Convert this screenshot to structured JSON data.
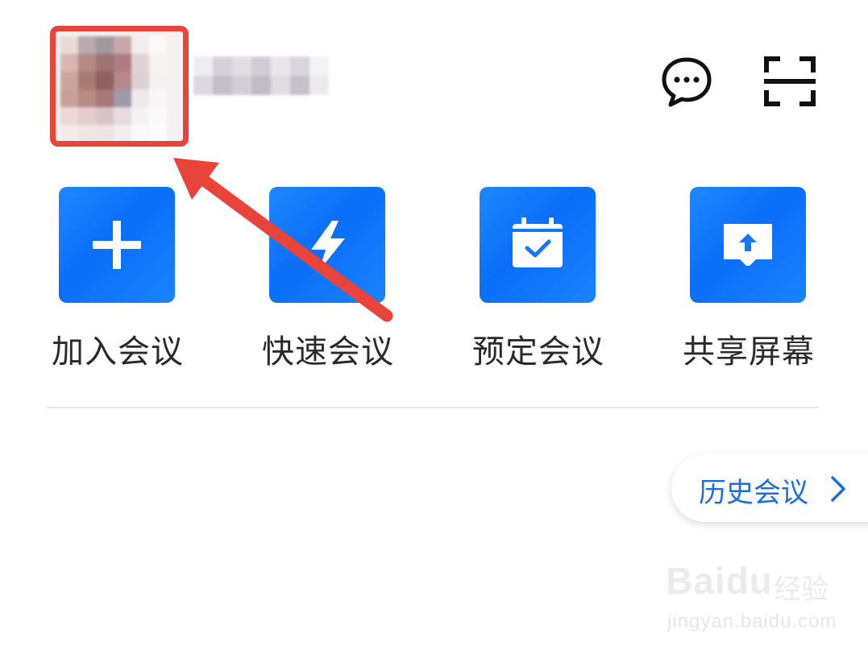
{
  "header": {
    "chat_icon": "chat-bubble-icon",
    "scan_icon": "scan-icon"
  },
  "actions": [
    {
      "label": "加入会议",
      "icon": "plus-icon"
    },
    {
      "label": "快速会议",
      "icon": "lightning-icon"
    },
    {
      "label": "预定会议",
      "icon": "calendar-check-icon"
    },
    {
      "label": "共享屏幕",
      "icon": "screen-share-icon"
    }
  ],
  "history": {
    "label": "历史会议",
    "icon": "chevron-right-icon"
  },
  "watermark": {
    "logo": "Baidu",
    "experience": "经验",
    "url": "jingyan.baidu.com"
  },
  "colors": {
    "accent": "#1677ff",
    "annotation": "#e8443b",
    "link": "#1a6fd8"
  }
}
